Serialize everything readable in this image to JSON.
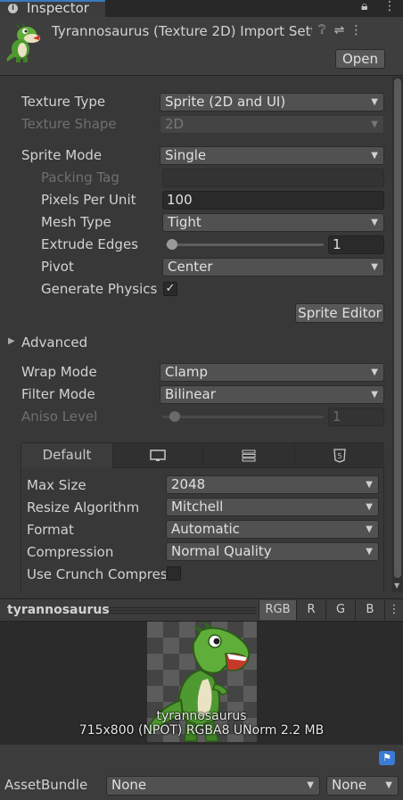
{
  "window": {
    "tab_title": "Inspector",
    "tab_icon": "info-icon"
  },
  "header": {
    "title": "Tyrannosaurus (Texture 2D) Import Sett",
    "open_label": "Open"
  },
  "texture": {
    "texture_type_label": "Texture Type",
    "texture_type_value": "Sprite (2D and UI)",
    "texture_shape_label": "Texture Shape",
    "texture_shape_value": "2D",
    "sprite_mode_label": "Sprite Mode",
    "sprite_mode_value": "Single",
    "packing_tag_label": "Packing Tag",
    "packing_tag_value": "",
    "pixels_per_unit_label": "Pixels Per Unit",
    "pixels_per_unit_value": "100",
    "mesh_type_label": "Mesh Type",
    "mesh_type_value": "Tight",
    "extrude_edges_label": "Extrude Edges",
    "extrude_edges_value": "1",
    "pivot_label": "Pivot",
    "pivot_value": "Center",
    "generate_physics_label": "Generate Physics S",
    "generate_physics_checked": true,
    "sprite_editor_label": "Sprite Editor",
    "advanced_label": "Advanced",
    "wrap_mode_label": "Wrap Mode",
    "wrap_mode_value": "Clamp",
    "filter_mode_label": "Filter Mode",
    "filter_mode_value": "Bilinear",
    "aniso_level_label": "Aniso Level",
    "aniso_level_value": "1"
  },
  "platform": {
    "tabs": [
      {
        "label": "Default",
        "icon": ""
      },
      {
        "label": "",
        "icon": "monitor-icon"
      },
      {
        "label": "",
        "icon": "server-icon"
      },
      {
        "label": "",
        "icon": "html5-icon"
      }
    ],
    "max_size_label": "Max Size",
    "max_size_value": "2048",
    "resize_algorithm_label": "Resize Algorithm",
    "resize_algorithm_value": "Mitchell",
    "format_label": "Format",
    "format_value": "Automatic",
    "compression_label": "Compression",
    "compression_value": "Normal Quality",
    "use_crunch_label": "Use Crunch Compres",
    "use_crunch_checked": false
  },
  "preview": {
    "title": "tyrannosaurus",
    "channels": [
      "RGB",
      "R",
      "G",
      "B"
    ],
    "active_channel": "RGB",
    "name": "tyrannosaurus",
    "info": "715x800 (NPOT)  RGBA8 UNorm   2.2 MB"
  },
  "asset_bundle": {
    "label": "AssetBundle",
    "bundle_value": "None",
    "variant_value": "None"
  }
}
